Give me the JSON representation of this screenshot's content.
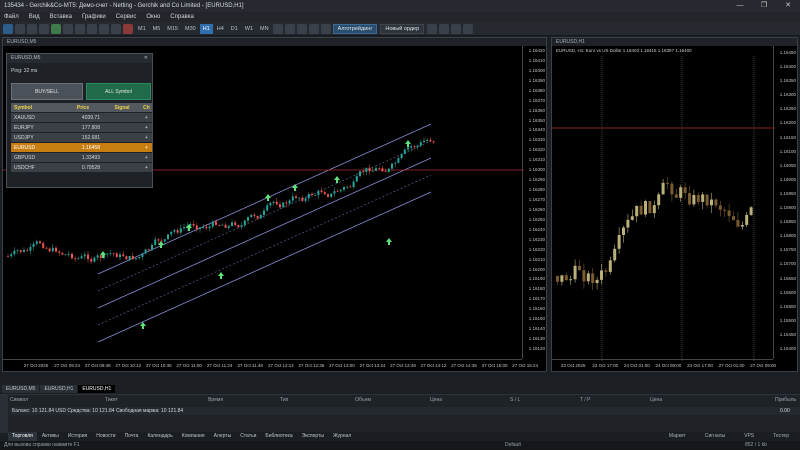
{
  "window": {
    "title": "135434 - Gerchik&Co-MT5: Демо-счет - Netting - Gerchik and Co Limited - [EURUSD,H1]",
    "buttons": [
      "—",
      "❐",
      "✕"
    ]
  },
  "menu": [
    "Файл",
    "Вид",
    "Вставка",
    "Графики",
    "Сервис",
    "Окно",
    "Справка"
  ],
  "toolbar": {
    "timeframes": [
      "M1",
      "M5",
      "M15",
      "M30",
      "H1",
      "H4",
      "D1",
      "W1",
      "MN"
    ],
    "active_timeframe": "H1",
    "algo_label": "Алготрейдинг",
    "new_order_label": "Новый ордер"
  },
  "chart1": {
    "title": "EURUSD,M5",
    "prices": [
      "1.16420",
      "1.16410",
      "1.16400",
      "1.16390",
      "1.16380",
      "1.16370",
      "1.16360",
      "1.16350",
      "1.16340",
      "1.16330",
      "1.16320",
      "1.16310",
      "1.16300",
      "1.16290",
      "1.16280",
      "1.16270",
      "1.16260",
      "1.16250",
      "1.16240",
      "1.16230",
      "1.16220",
      "1.16210",
      "1.16200",
      "1.16190",
      "1.16180",
      "1.16170",
      "1.16160",
      "1.16150",
      "1.16140",
      "1.16130",
      "1.16120"
    ],
    "times": [
      "27 Oct 2025",
      "27 Oct 09:24",
      "27 Oct 09:48",
      "27 Oct 10:12",
      "27 Oct 10:36",
      "27 Oct 11:00",
      "27 Oct 11:24",
      "27 Oct 11:48",
      "27 Oct 12:12",
      "27 Oct 12:36",
      "27 Oct 13:00",
      "27 Oct 13:24",
      "27 Oct 13:48",
      "27 Oct 14:12",
      "27 Oct 14:36",
      "27 Oct 15:00",
      "27 Oct 15:24"
    ],
    "current_price": "1.16398"
  },
  "chart2": {
    "title": "EURUSD,H1",
    "subtitle": "EURUSD, H1: Euro vs US Dollar 1.16403 1.16415 1.16397 1.16400",
    "prices": [
      "1.16450",
      "1.16400",
      "1.16350",
      "1.16300",
      "1.16250",
      "1.16200",
      "1.16150",
      "1.16100",
      "1.16050",
      "1.16000",
      "1.15950",
      "1.15900",
      "1.15850",
      "1.15800",
      "1.15750",
      "1.15700",
      "1.15650",
      "1.15600",
      "1.15550",
      "1.15500",
      "1.15450",
      "1.15400"
    ],
    "times": [
      "23 Oct 2025",
      "23 Oct 17:00",
      "24 Oct 01:00",
      "24 Oct 09:00",
      "24 Oct 17:00",
      "27 Oct 01:00",
      "27 Oct 09:00"
    ],
    "current_price": "1.16400"
  },
  "market": {
    "title": "EURUSD,M5",
    "ping": "Ping: 32 ms",
    "buysell_label": "BUY/SELL",
    "all_label": "ALL Symbol",
    "columns": [
      "Symbol",
      "Price",
      "Signal",
      "Ch"
    ],
    "rows": [
      {
        "symbol": "XAUUSD",
        "price": "4039.71",
        "signal": "",
        "ch": "+"
      },
      {
        "symbol": "EURJPY",
        "price": "177.808",
        "signal": "",
        "ch": "+"
      },
      {
        "symbol": "USDJPY",
        "price": "152.681",
        "signal": "",
        "ch": "+"
      },
      {
        "symbol": "EURUSD",
        "price": "1.16458",
        "signal": "",
        "ch": "+"
      },
      {
        "symbol": "GBPUSD",
        "price": "1.33493",
        "signal": "",
        "ch": "+"
      },
      {
        "symbol": "USDCHF",
        "price": "0.79528",
        "signal": "",
        "ch": "+"
      }
    ]
  },
  "chart_tabs": [
    "EURUSD,M5",
    "EURUSD,H1",
    "EURUSD,H1"
  ],
  "toolbox": {
    "columns": [
      "Символ",
      "Тикет",
      "Время",
      "Тип",
      "Объем",
      "Цена",
      "S / L",
      "T / P",
      "Цена",
      "Прибыль"
    ],
    "balance_text": "Баланс: 10 121.84 USD  Средства: 10 121.84  Свободная маржа: 10 121.84",
    "profit": "0.00",
    "tabs": [
      "Торговля",
      "Активы",
      "История",
      "Новости",
      "Почта",
      "Календарь",
      "Компания",
      "Алерты",
      "Статьи",
      "Библиотека",
      "Эксперты",
      "Журнал"
    ],
    "right": [
      "Маркет",
      "Сигналы",
      "VPS",
      "Тестер"
    ]
  },
  "status": {
    "help": "Для вызова справки нажмите F1",
    "profile": "Default",
    "conn": "852 / 1 kb"
  },
  "colors": {
    "bull": "#26a69a",
    "bear": "#ef5350",
    "channel": "#8a8fd6",
    "current_line": "#b02a2a",
    "highlight_row": "#c87d11"
  }
}
